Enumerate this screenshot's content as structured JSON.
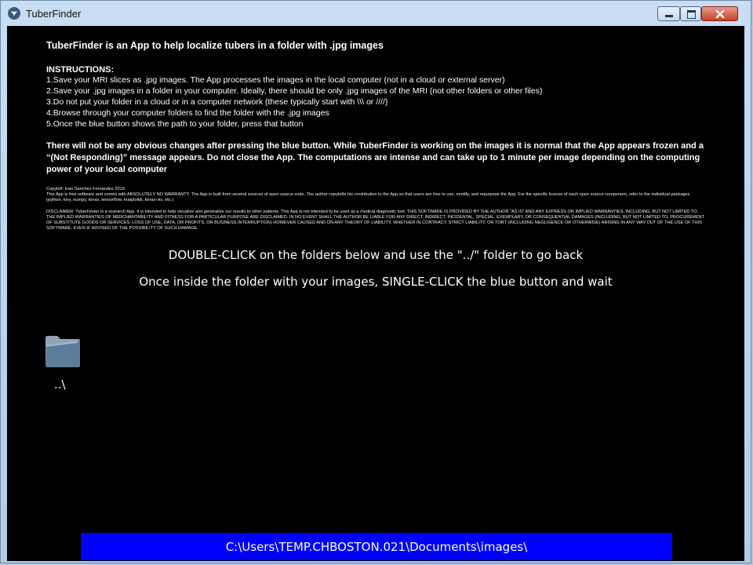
{
  "window": {
    "title": "TuberFinder",
    "app_icon": "tuberfinder-app-icon",
    "controls": [
      "minimize-icon",
      "maximize-icon",
      "close-icon"
    ]
  },
  "intro": {
    "headline": "TuberFinder is an App to help localize tubers in a folder with .jpg images",
    "instructions_title": "INSTRUCTIONS:",
    "instructions": [
      "1.Save your MRI slices as .jpg images. The App processes the images in the local computer (not in a cloud or external server)",
      "2.Save your .jpg images in a folder in your computer. Ideally, there should be only .jpg images of the MRI (not other folders or other files)",
      "3.Do not put your folder in a cloud or in a computer network (these typically start with \\\\\\ or ////)",
      "4.Browse through your computer folders to find the folder with the .jpg images",
      "5.Once the blue button shows the path to your folder, press that button"
    ],
    "warning": "There will not be any obvious changes after pressing the blue button. While TuberFinder is working on the images it is normal that the App appears frozen and a “(Not Responding)” message appears. Do not close the App. The computations are intense and can take up to 1 minute per image depending on the computing power of your local computer",
    "copyright": "Copyleft: Ivan Sanchez Fernandez  2019",
    "license": "This App is free software and comes with ABSOLUTELY NO WARRANTY. The App is built from several sources of open source code. The author copylefts his contribution to the App so that users are free to use, modify, and repurpose the App. For the specific license of each open source component, refer to the individual packages (python, kivy, numpy, keras, tensorflow, matplotlib, keras-vis, etc.)",
    "disclaimer": "DISCLAIMER: TuberFinder is a research App. It is intended to help visualize and generalize our results to other patients. This App is not intended to be used as a medical diagnostic tool. THIS SOFTWARE IS PROVIDED BY THE AUTHOR \"AS IS\" AND ANY EXPRESS OR IMPLIED WARRANTIES, INCLUDING, BUT NOT LIMITED TO, THE IMPLIED WARRANTIES OF MERCHANTABILITY AND FITNESS FOR A PARTICULAR PURPOSE ARE DISCLAIMED. IN NO EVENT SHALL THE AUTHOR BE LIABLE FOR ANY DIRECT, INDIRECT, INCIDENTAL, SPECIAL, EXEMPLARY, OR CONSEQUENTIAL DAMAGES (INCLUDING, BUT NOT LIMITED TO, PROCUREMENT OF SUBSTITUTE GOODS OR SERVICES; LOSS OF USE, DATA, OR PROFITS; OR BUSINESS INTERRUPTION) HOWEVER CAUSED AND ON ANY THEORY OF LIABILITY, WHETHER IN CONTRACT, STRICT LIABILITY, OR TORT (INCLUDING NEGLIGENCE OR OTHERWISE) ARISING IN ANY WAY OUT OF THE USE OF THIS SOFTWARE, EVEN IF ADVISED OF THE POSSIBILITY OF SUCH DAMAGE."
  },
  "hints": {
    "double_click": "DOUBLE-CLICK on the folders below and use the \"../\" folder to go back",
    "single_click": "Once inside the folder with your images, SINGLE-CLICK the blue button and wait"
  },
  "browser": {
    "items": [
      {
        "label": "..\\",
        "icon": "folder-icon"
      }
    ]
  },
  "path_button": {
    "label": "C:\\Users\\TEMP.CHBOSTON.021\\Documents\\images\\",
    "color": "#0000ff"
  }
}
